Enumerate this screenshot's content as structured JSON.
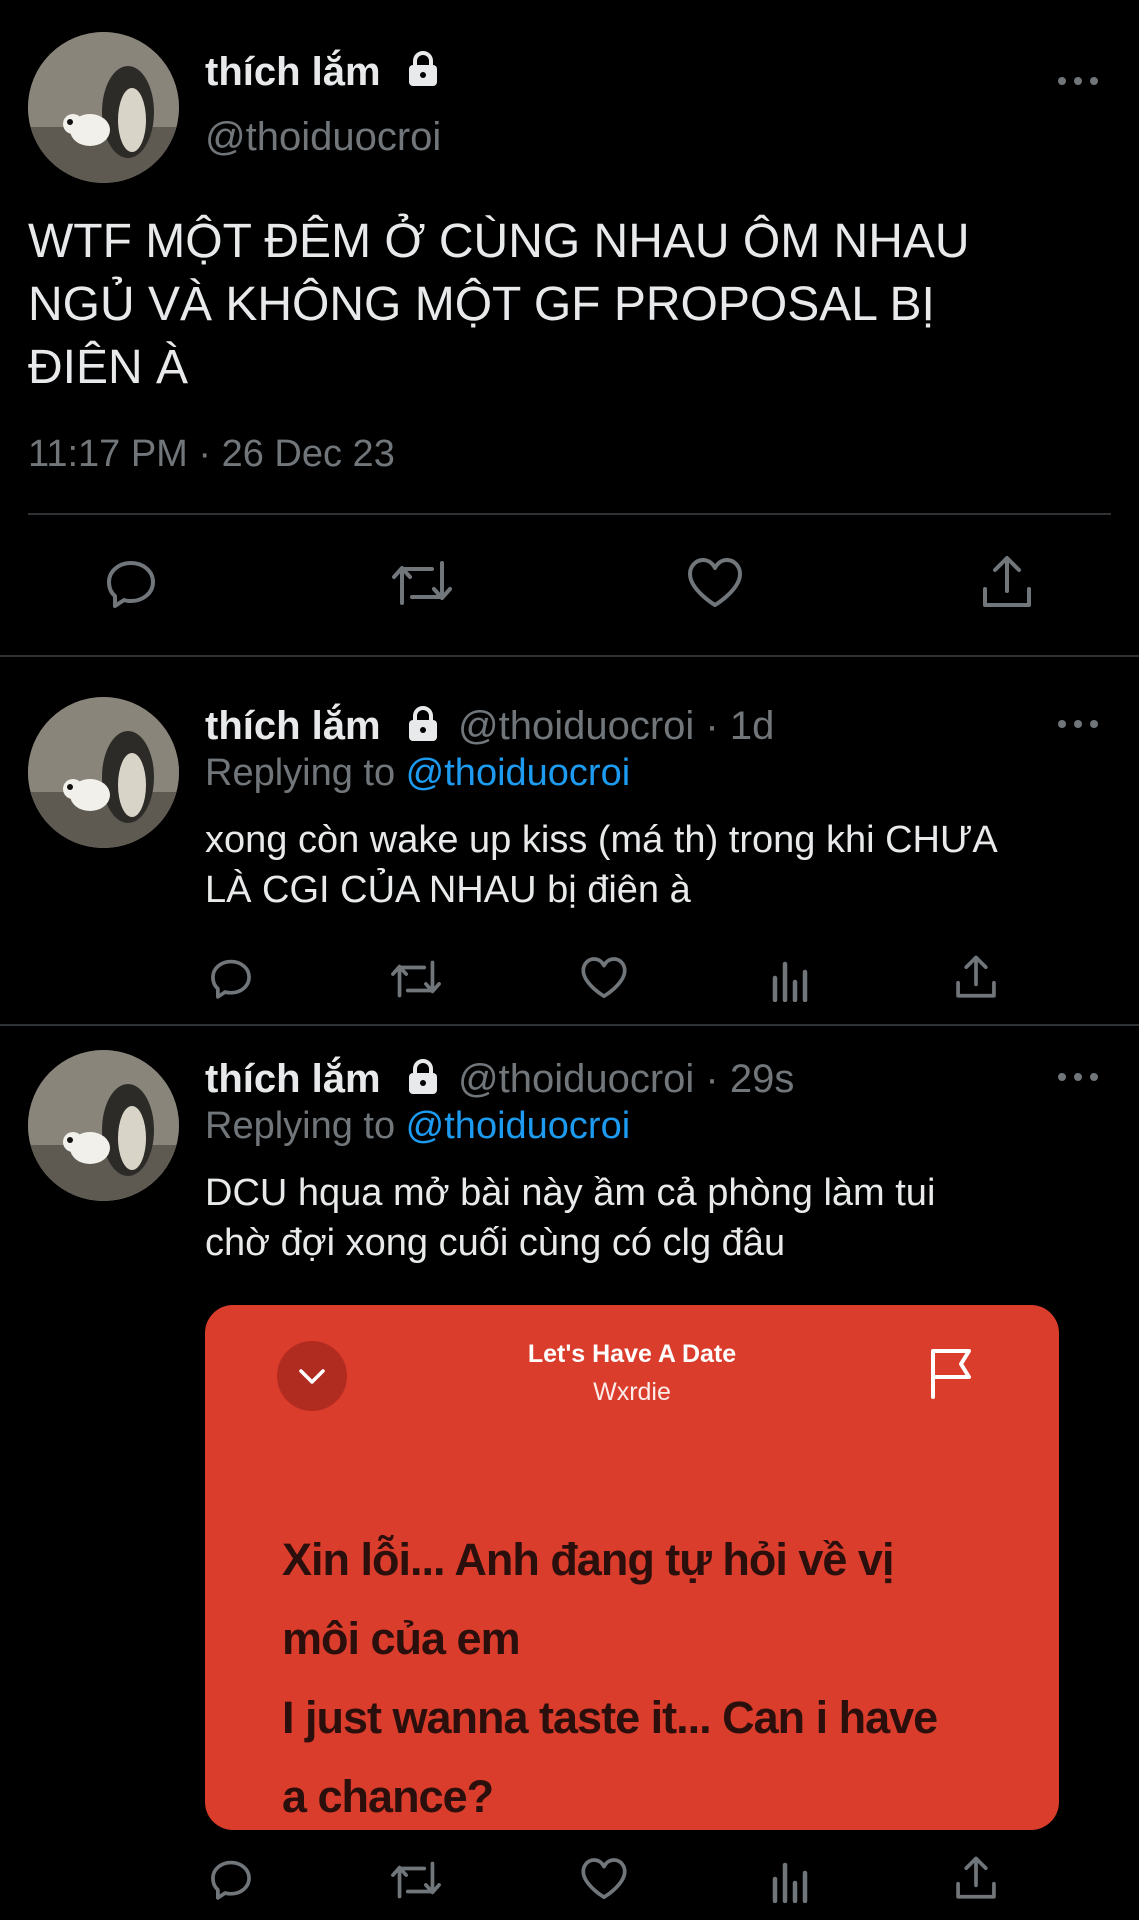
{
  "main_tweet": {
    "display_name": "thích lắm",
    "handle": "@thoiduocroi",
    "text_lines": [
      "WTF MỘT ĐÊM Ở CÙNG NHAU ÔM NHAU",
      "NGỦ VÀ KHÔNG MỘT GF PROPOSAL BỊ",
      "ĐIÊN À"
    ],
    "timestamp": "11:17 PM · 26 Dec 23"
  },
  "reply1": {
    "display_name": "thích lắm",
    "handle_time": "@thoiduocroi · 1d",
    "replying_prefix": "Replying to ",
    "replying_handle": "@thoiduocroi",
    "text_lines": [
      "xong còn wake up kiss (má th) trong khi CHƯA",
      "LÀ CGI CỦA NHAU bị điên à"
    ]
  },
  "reply2": {
    "display_name": "thích lắm",
    "handle_time": "@thoiduocroi · 29s",
    "replying_prefix": "Replying to ",
    "replying_handle": "@thoiduocroi",
    "text_lines": [
      "DCU hqua mở bài này ầm cả phòng làm tui",
      "chờ đợi xong cuối cùng có clg đâu"
    ]
  },
  "lyrics_card": {
    "song_title": "Let's Have A Date",
    "artist": "Wxrdie",
    "lyric_lines": [
      "Xin lỗi... Anh đang tự hỏi về vị",
      "môi của em",
      "I just wanna taste it... Can i have",
      "a chance?"
    ],
    "background_color": "#db3d2c"
  },
  "icons": [
    "lock-icon",
    "more-icon",
    "reply-icon",
    "retweet-icon",
    "like-icon",
    "share-icon",
    "views-icon",
    "chevron-down-icon",
    "flag-icon"
  ],
  "colors": {
    "background": "#000000",
    "text": "#e7e9ea",
    "muted": "#71767b",
    "link": "#1d9bf0",
    "divider": "#2f3336"
  }
}
